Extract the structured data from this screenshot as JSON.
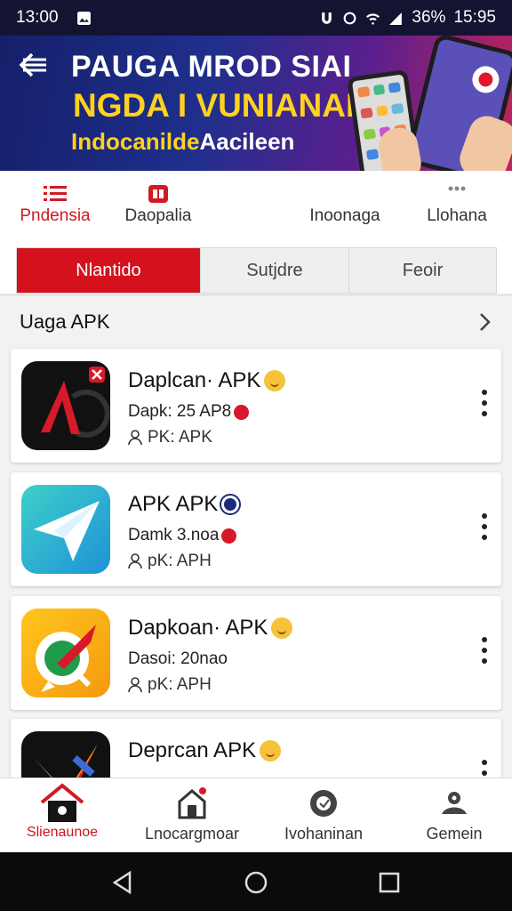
{
  "status_bar": {
    "time_left": "13:00",
    "battery": "36%",
    "time_right": "15:95"
  },
  "banner": {
    "line1": "PAUGA MROD SIAI",
    "line2": "NGDA I VUNIANAN",
    "line3_a": "Indocanilde",
    "line3_b": "Aacileen"
  },
  "categories": [
    {
      "label": "Pndensia",
      "icon": "list-icon"
    },
    {
      "label": "Daopalia",
      "icon": "app-badge-icon"
    },
    {
      "label": "Inoonaga",
      "icon": ""
    },
    {
      "label": "Llohana",
      "icon": "dots-icon"
    }
  ],
  "segments": [
    "Nlantido",
    "Sutjdre",
    "Feoir"
  ],
  "section": {
    "title": "Uaga APK"
  },
  "apps": [
    {
      "title": "Daplcan· APK",
      "meta": "Dapk: 25 AP8",
      "sub": "PK: APK",
      "badge": "emoji"
    },
    {
      "title": "APK APK",
      "meta": "Damk 3.noa",
      "sub": "pK: APH",
      "badge": "blue"
    },
    {
      "title": "Dapkoan· APK",
      "meta": "Dasoi: 20nao",
      "sub": "pK: APH",
      "badge": "emoji"
    },
    {
      "title": "Deprcan APK",
      "meta": "",
      "sub": "",
      "badge": "emoji"
    }
  ],
  "bottom_nav": [
    {
      "label": "Slienaunoe",
      "icon": "home-icon"
    },
    {
      "label": "Lnocargmoar",
      "icon": "store-icon"
    },
    {
      "label": "Ivohaninan",
      "icon": "shield-icon"
    },
    {
      "label": "Gemein",
      "icon": "game-icon"
    }
  ],
  "colors": {
    "accent": "#d5111e",
    "banner_dark": "#15206a",
    "highlight_yellow": "#ffd21e"
  }
}
